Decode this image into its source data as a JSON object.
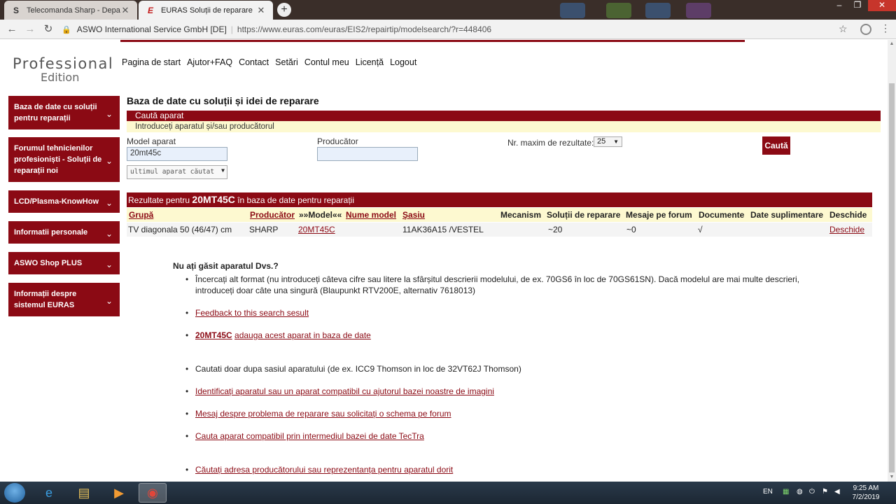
{
  "browser": {
    "tabs": [
      {
        "title": "Telecomanda Sharp - Depanari R",
        "favicon": "S"
      },
      {
        "title": "EURAS Soluții de reparare",
        "favicon": "E"
      }
    ],
    "new_tab_label": "+",
    "site_name": "ASWO International Service GmbH [DE]",
    "url": "https://www.euras.com/euras/EIS2/repairtip/modelsearch/?r=448406"
  },
  "brand": {
    "line1": "Professional",
    "line2": "Edition"
  },
  "topnav": [
    "Pagina de start",
    "Ajutor+FAQ",
    "Contact",
    "Setări",
    "Contul meu",
    "Licență",
    "Logout"
  ],
  "sidebar": {
    "items": [
      {
        "label": "Baza de date cu soluții pentru reparații"
      },
      {
        "label": "Forumul tehnicienilor profesioniști - Soluții de reparații noi"
      },
      {
        "label": "LCD/Plasma-KnowHow"
      },
      {
        "label": "Informatii personale"
      },
      {
        "label": "ASWO Shop PLUS"
      },
      {
        "label": "Informații despre sistemul EURAS"
      }
    ]
  },
  "main": {
    "title": "Baza de date cu soluții și idei de reparare",
    "search_header": "Caută aparat",
    "search_hint": "Introduceți aparatul și/sau producătorul",
    "model_label": "Model aparat",
    "model_value": "20mt45c",
    "last_device_select": "ultimul aparat căutat",
    "manufacturer_label": "Producător",
    "manufacturer_value": "",
    "max_results_label": "Nr. maxim de rezultate:",
    "max_results_value": "25",
    "search_button": "Caută"
  },
  "results": {
    "header_prefix": "Rezultate pentru",
    "query": "20MT45C",
    "header_suffix": "în baza de date pentru reparații",
    "columns": {
      "group": "Grupă",
      "manufacturer": "Producător",
      "model": "»»Model««",
      "model_name": "Nume model",
      "chassis": "Şasiu",
      "mechanism": "Mecanism",
      "solutions": "Soluții de reparare",
      "forum": "Mesaje pe forum",
      "documents": "Documente",
      "extra": "Date suplimentare",
      "open": "Deschide"
    },
    "rows": [
      {
        "group": "TV diagonala 50 (46/47) cm",
        "manufacturer": "SHARP",
        "model": "20MT45C",
        "model_name": "",
        "chassis": "11AK36A15 /VESTEL",
        "mechanism": "",
        "solutions": "~20",
        "forum": "~0",
        "documents": "√",
        "extra": "",
        "open": "Deschide"
      }
    ]
  },
  "help": {
    "title": "Nu ați găsit aparatul Dvs.?",
    "tip_format": "Încercați alt format (nu introduceți câteva cifre sau litere la sfârșitul descrierii modelului, de ex. 70GS6 în loc de 70GS61SN). Dacă modelul are mai multe descrieri, introduceți doar câte una singură (Blaupunkt RTV200E, alternativ 7618013)",
    "feedback_link": "Feedback to this search sesult",
    "add_model": "20MT45C",
    "add_link": "adauga acest aparat in baza de date",
    "tip_chassis": "Cautati doar dupa sasiul aparatului (de ex. ICC9 Thomson in loc de 32VT62J Thomson)",
    "identify_link": "Identificați aparatul sau un aparat compatibil cu ajutorul bazei noastre de imagini",
    "forum_link": "Mesaj despre problema de reparare sau solicitați o schema pe forum",
    "tectra_link": "Cauta aparat compatibil prin intermediul bazei de date TecTra",
    "address_link": "Căutați adresa producătorului sau reprezentanța pentru aparatul dorit"
  },
  "taskbar": {
    "language": "EN",
    "time": "9:25 AM",
    "date": "7/2/2019"
  },
  "colors": {
    "brand_red": "#8b0a14",
    "hint_yellow": "#fdf9d0"
  }
}
